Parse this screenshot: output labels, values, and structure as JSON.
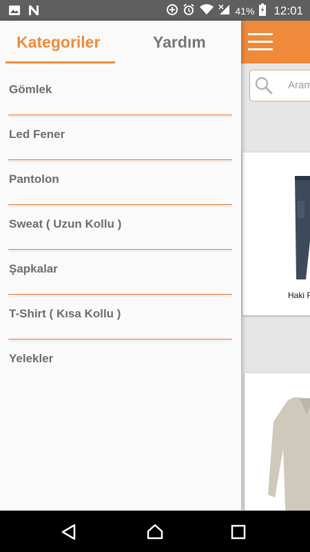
{
  "status_bar": {
    "battery_percent": "41%",
    "time": "12:01",
    "left_icons": [
      "image-icon",
      "n-icon"
    ],
    "right_icons": [
      "data-saver-icon",
      "alarm-icon",
      "wifi-icon",
      "signal-icon",
      "battery-charging-icon"
    ]
  },
  "drawer": {
    "tabs": [
      {
        "label": "Kategoriler",
        "active": true
      },
      {
        "label": "Yardım",
        "active": false
      }
    ],
    "categories": [
      {
        "label": "Gömlek"
      },
      {
        "label": "Led Fener"
      },
      {
        "label": "Pantolon"
      },
      {
        "label": "Sweat ( Uzun Kollu )"
      },
      {
        "label": "Şapkalar"
      },
      {
        "label": "T-Shirt ( Kısa Kollu )"
      },
      {
        "label": "Yelekler"
      }
    ]
  },
  "main": {
    "menu_icon": "hamburger-icon",
    "search": {
      "placeholder": "Arama"
    },
    "products": [
      {
        "name": "Haki Pantolon"
      },
      {
        "name": ""
      }
    ]
  },
  "nav_bar": {
    "buttons": [
      "back-icon",
      "home-icon",
      "recents-icon"
    ]
  },
  "colors": {
    "accent": "#f08a3a",
    "status_bar": "#5f5f5f",
    "tab_inactive": "#767676",
    "category_text": "#6d6d6d"
  }
}
